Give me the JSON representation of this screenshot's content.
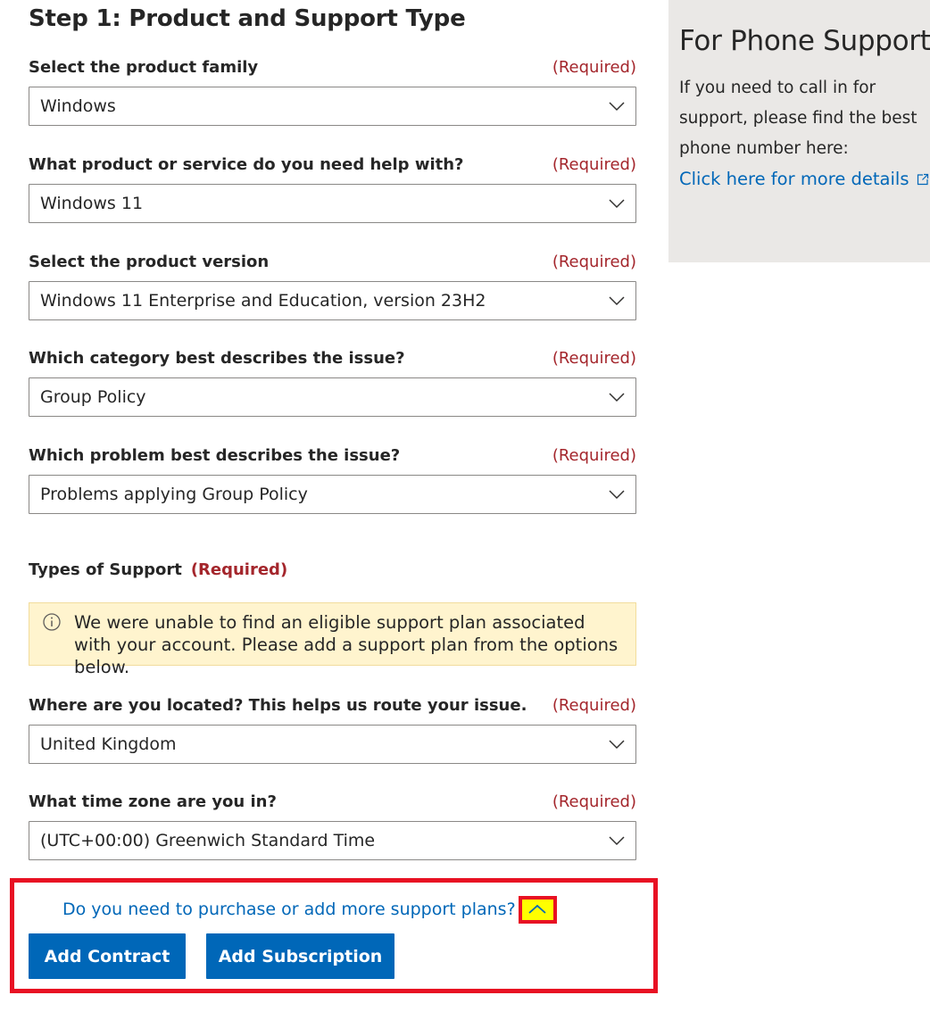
{
  "step": {
    "title": "Step 1: Product and Support Type"
  },
  "required_text": "(Required)",
  "fields": [
    {
      "label": "Select the product family",
      "required": "(Required)",
      "value": "Windows"
    },
    {
      "label": "What product or service do you need help with?",
      "required": "(Required)",
      "value": "Windows 11"
    },
    {
      "label": "Select the product version",
      "required": "(Required)",
      "value": "Windows 11 Enterprise and Education, version 23H2"
    },
    {
      "label": "Which category best describes the issue?",
      "required": "(Required)",
      "value": "Group Policy"
    },
    {
      "label": "Which problem best describes the issue?",
      "required": "(Required)",
      "value": "Problems applying Group Policy"
    }
  ],
  "support_types": {
    "label": "Types of Support",
    "required": "(Required)",
    "warning_icon": "info-icon",
    "warning": "We were unable to find an eligible support plan associated with your account. Please add a support plan from the options below."
  },
  "location": {
    "label": "Where are you located? This helps us route your issue.",
    "required": "(Required)",
    "value": "United Kingdom"
  },
  "timezone": {
    "label": "What time zone are you in?",
    "required": "(Required)",
    "value": "(UTC+00:00) Greenwich Standard Time"
  },
  "purchase": {
    "question": "Do you need to purchase or add more support plans?",
    "toggle_icon": "chevron-up-icon",
    "add_contract": "Add Contract",
    "add_subscription": "Add Subscription"
  },
  "phone_support": {
    "title": "For Phone Support",
    "text": "If you need to call in for support, please find the best phone number here:",
    "link": "Click here for more details",
    "link_icon": "external-link-icon"
  },
  "colors": {
    "accent": "#0067b8",
    "required": "#a4262c",
    "warning_bg": "#fff4ce",
    "highlight_border": "#e81123",
    "highlight_fill": "#ffff00",
    "side_panel": "#eae8e6"
  }
}
